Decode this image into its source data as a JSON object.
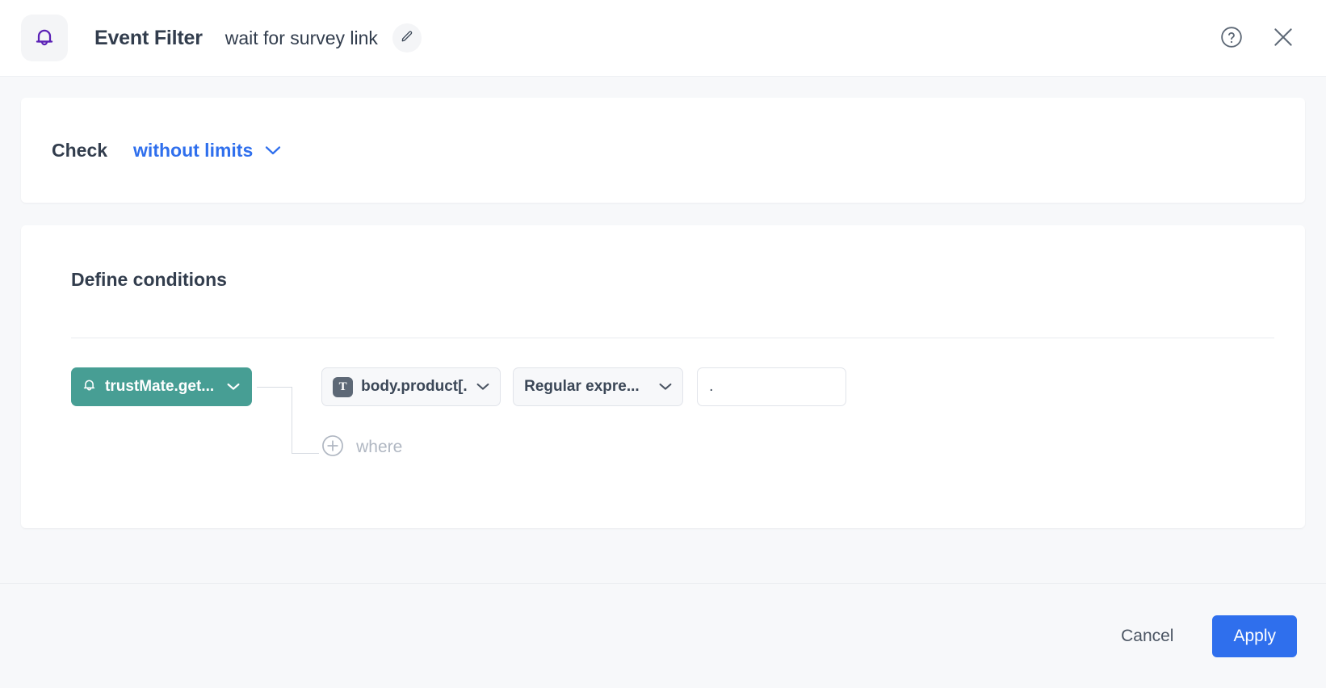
{
  "header": {
    "icon": "bell-icon",
    "title": "Event Filter",
    "subtitle": "wait for survey link",
    "edit_icon": "pencil-icon",
    "help_icon": "help-circle-icon",
    "close_icon": "close-icon",
    "icon_color": "#5b21b6"
  },
  "check": {
    "label": "Check",
    "selected": "without limits",
    "chevron_icon": "chevron-down-icon",
    "accent_color": "#2f6fed"
  },
  "conditions": {
    "title": "Define conditions",
    "event": {
      "icon": "bell-icon",
      "label": "trustMate.get...",
      "chevron_icon": "chevron-down-icon",
      "color": "#479e94"
    },
    "rule": {
      "field_badge": "T",
      "field": "body.product[...",
      "operator": "Regular expre...",
      "value": ".",
      "value_placeholder": "",
      "chevron_icon": "chevron-down-icon"
    },
    "add_where": {
      "icon": "plus-circle-icon",
      "label": "where"
    }
  },
  "footer": {
    "cancel_label": "Cancel",
    "apply_label": "Apply",
    "apply_color": "#2f6fed"
  }
}
